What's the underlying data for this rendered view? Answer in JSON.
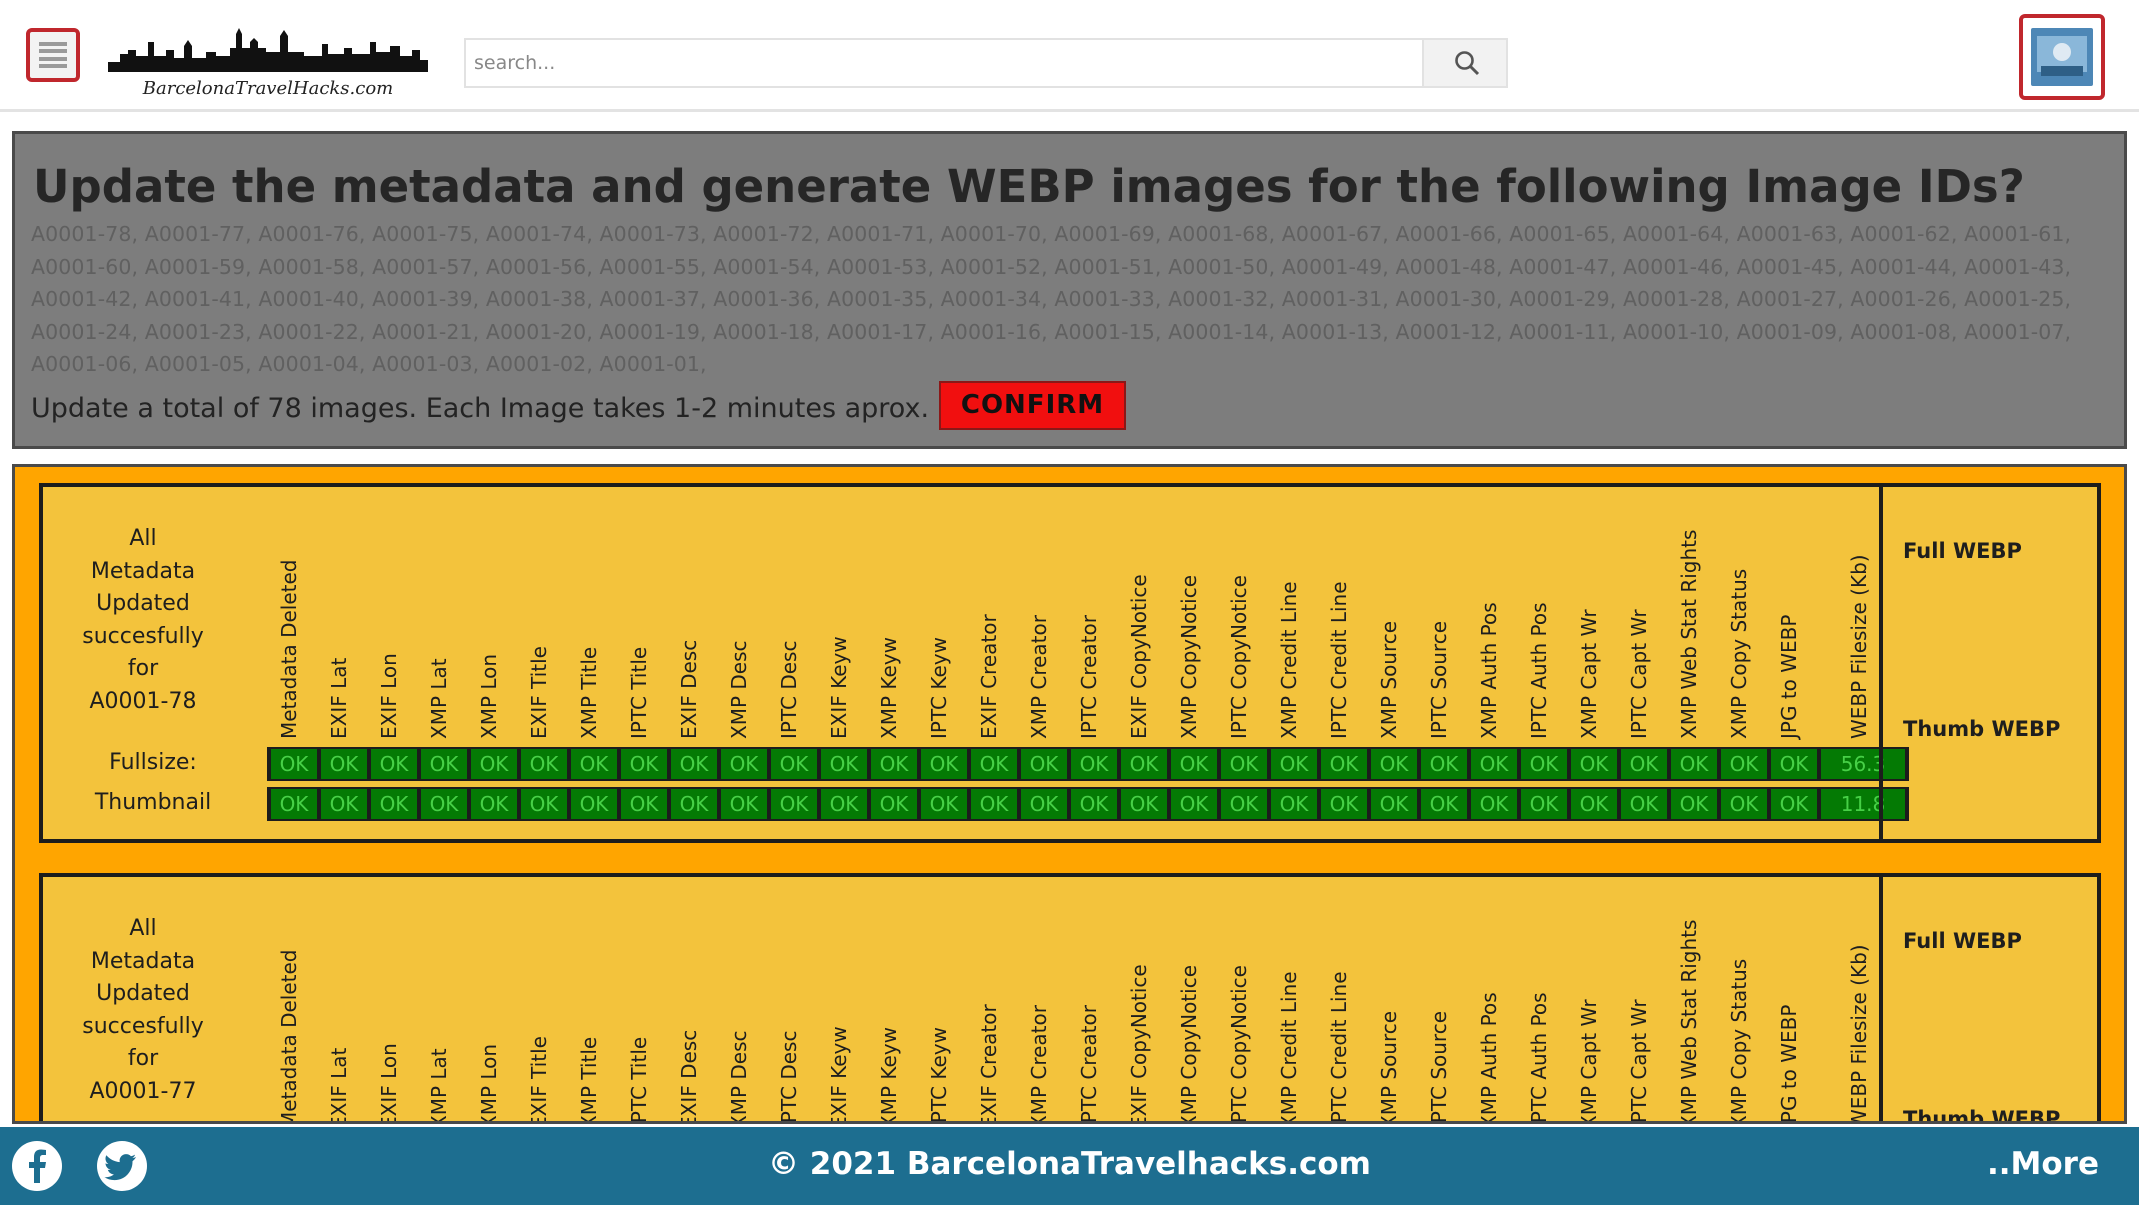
{
  "header": {
    "logo_text": "BarcelonaTravelHacks.com",
    "search_placeholder": "search..."
  },
  "confirm": {
    "title": "Update the metadata and generate WEBP images for the following Image IDs?",
    "id_list": "A0001-78, A0001-77, A0001-76, A0001-75, A0001-74, A0001-73, A0001-72, A0001-71, A0001-70, A0001-69, A0001-68, A0001-67, A0001-66, A0001-65, A0001-64, A0001-63, A0001-62, A0001-61, A0001-60, A0001-59, A0001-58, A0001-57, A0001-56, A0001-55, A0001-54, A0001-53, A0001-52, A0001-51, A0001-50, A0001-49, A0001-48, A0001-47, A0001-46, A0001-45, A0001-44, A0001-43, A0001-42, A0001-41, A0001-40, A0001-39, A0001-38, A0001-37, A0001-36, A0001-35, A0001-34, A0001-33, A0001-32, A0001-31, A0001-30, A0001-29, A0001-28, A0001-27, A0001-26, A0001-25, A0001-24, A0001-23, A0001-22, A0001-21, A0001-20, A0001-19, A0001-18, A0001-17, A0001-16, A0001-15, A0001-14, A0001-13, A0001-12, A0001-11, A0001-10, A0001-09, A0001-08, A0001-07, A0001-06, A0001-05, A0001-04, A0001-03, A0001-02, A0001-01,",
    "summary": "Update a total of 78 images. Each Image takes 1-2 minutes aprox.",
    "button_label": "CONFIRM"
  },
  "columns": [
    "Metadata Deleted",
    "EXIF Lat",
    "EXIF Lon",
    "XMP Lat",
    "XMP Lon",
    "EXIF Title",
    "XMP Title",
    "IPTC Title",
    "EXIF Desc",
    "XMP Desc",
    "IPTC Desc",
    "EXIF Keyw",
    "XMP Keyw",
    "IPTC Keyw",
    "EXIF Creator",
    "XMP Creator",
    "IPTC Creator",
    "EXIF CopyNotice",
    "XMP CopyNotice",
    "IPTC CopyNotice",
    "XMP Credit Line",
    "IPTC Credit Line",
    "XMP Source",
    "IPTC Source",
    "XMP Auth Pos",
    "IPTC Auth Pos",
    "XMP Capt Wr",
    "IPTC Capt Wr",
    "XMP Web Stat Rights",
    "XMP Copy Status",
    "JPG to WEBP",
    "WEBP Filesize (Kb)"
  ],
  "cards": [
    {
      "status_lines": [
        "All",
        "Metadata",
        "Updated",
        "succesfully",
        "for",
        "A0001-78"
      ],
      "rows": [
        {
          "label": "Fullsize:",
          "cell_text": "OK",
          "filesize": "56.3"
        },
        {
          "label": "Thumbnail",
          "cell_text": "OK",
          "filesize": "11.8"
        }
      ],
      "webp_full": "Full WEBP",
      "webp_thumb": "Thumb WEBP"
    },
    {
      "status_lines": [
        "All",
        "Metadata",
        "Updated",
        "succesfully",
        "for",
        "A0001-77"
      ],
      "rows": [],
      "webp_full": "Full WEBP",
      "webp_thumb": "Thumb WEBP"
    }
  ],
  "footer": {
    "copyright": "© 2021 BarcelonaTravelhacks.com",
    "more": "..More"
  },
  "colors": {
    "accent_red": "#c0272d",
    "confirm_red": "#f10f0f",
    "results_orange": "#ffa500",
    "card_yellow": "#f3c33c",
    "ok_green": "#047a04",
    "footer_blue": "#1d6e90"
  },
  "icons": {
    "menu": "hamburger-icon",
    "search": "magnifier-icon",
    "profile": "profile-image-icon",
    "facebook": "facebook-icon",
    "twitter": "twitter-icon"
  }
}
